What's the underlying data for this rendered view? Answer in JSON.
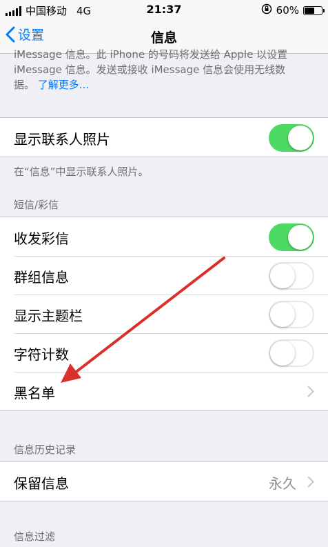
{
  "status_bar": {
    "carrier": "中国移动",
    "network": "4G",
    "time": "21:37",
    "battery": "60%",
    "battery_level": 0.6
  },
  "nav": {
    "back_label": "设置",
    "title": "信息"
  },
  "imessage_footer": {
    "line1": "iMessage 信息。此 iPhone 的号码将发送给 Apple 以设置",
    "line2": "iMessage 信息。发送或接收 iMessage 信息会使用无线数",
    "line3_prefix": "据。",
    "link": "了解更多..."
  },
  "contact_photos": {
    "label": "显示联系人照片",
    "enabled": true,
    "footer": "在“信息”中显示联系人照片。"
  },
  "sms_mms": {
    "header": "短信/彩信",
    "items": [
      {
        "label": "收发彩信",
        "enabled": true
      },
      {
        "label": "群组信息",
        "enabled": false
      },
      {
        "label": "显示主题栏",
        "enabled": false
      },
      {
        "label": "字符计数",
        "enabled": false
      }
    ],
    "blacklist_label": "黑名单"
  },
  "history": {
    "header": "信息历史记录",
    "keep_label": "保留信息",
    "keep_value": "永久"
  },
  "filter": {
    "header": "信息过滤"
  },
  "colors": {
    "accent": "#007aff",
    "switch_on": "#4cd964",
    "annotation_arrow": "#d9302c"
  },
  "annotation": "red-arrow pointing to blacklist"
}
